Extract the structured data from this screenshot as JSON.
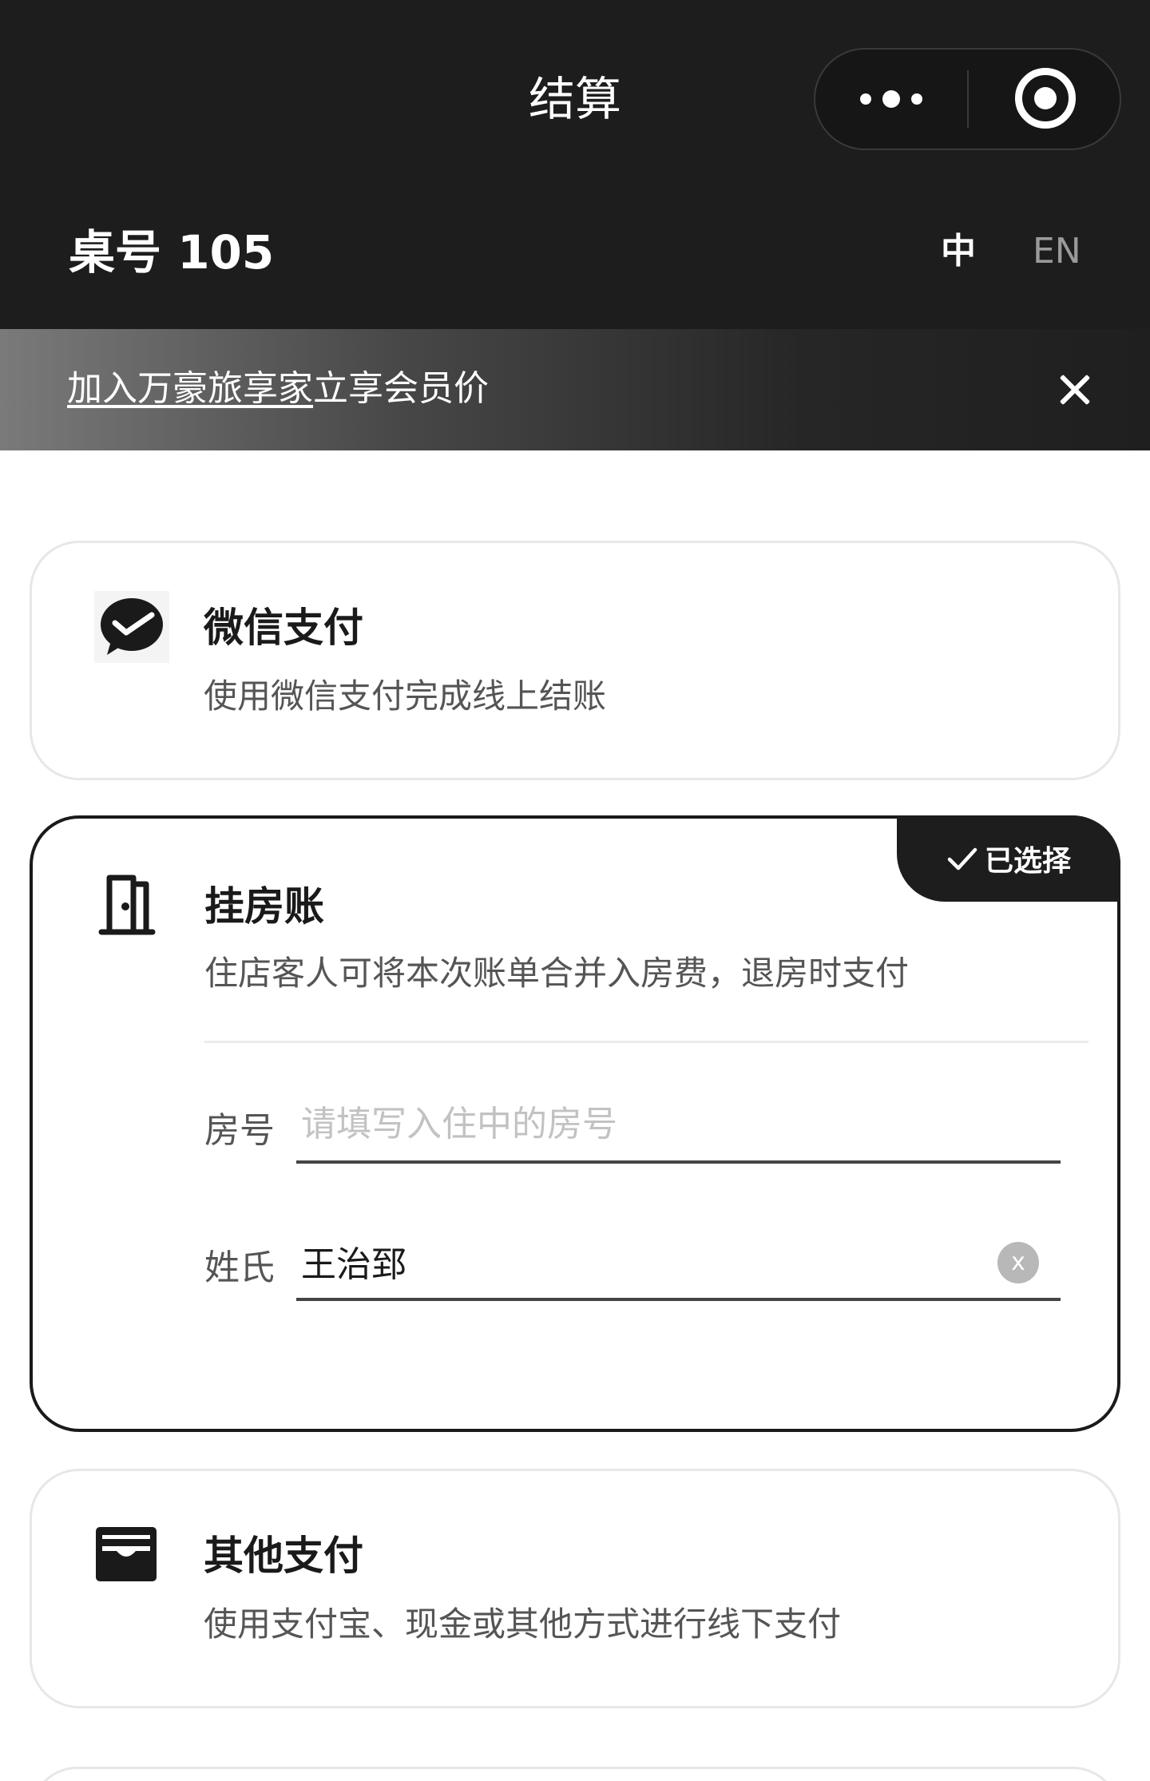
{
  "nav": {
    "title": "结算",
    "more_icon": "more-dots-icon",
    "close_icon": "target-close-icon"
  },
  "header": {
    "table_label": "桌号 105",
    "lang_zh": "中",
    "lang_en": "EN"
  },
  "banner": {
    "link_text": "加入万豪旅享家",
    "rest_text": "立享会员价",
    "close_icon": "close-icon"
  },
  "payment_options": {
    "wechat": {
      "icon": "wechat-pay-icon",
      "title": "微信支付",
      "description": "使用微信支付完成线上结账"
    },
    "room_charge": {
      "icon": "door-icon",
      "title": "挂房账",
      "description": "住店客人可将本次账单合并入房费，退房时支付",
      "selected_badge": "已选择",
      "room_label": "房号",
      "room_placeholder": "请填写入住中的房号",
      "room_value": "",
      "surname_label": "姓氏",
      "surname_value": "王治郅",
      "clear_label": "x"
    },
    "other": {
      "icon": "wallet-icon",
      "title": "其他支付",
      "description": "使用支付宝、现金或其他方式进行线下支付"
    }
  },
  "colors": {
    "header_bg": "#1d1d1d",
    "accent": "#1a1a1a",
    "card_border": "#e7e7e7"
  }
}
